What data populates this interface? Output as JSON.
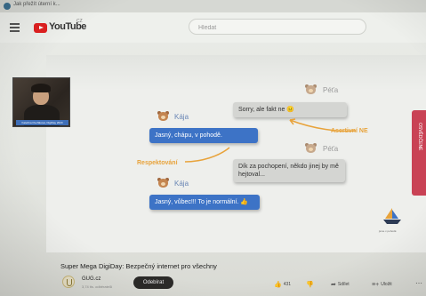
{
  "browser": {
    "tab_title": "Jak přežít úterní k..."
  },
  "header": {
    "logo_text": "YouTube",
    "region": "CZ",
    "search_placeholder": "Hledat"
  },
  "slide": {
    "participants": {
      "kaja_top": "Kája",
      "peta_top": "Péťa",
      "peta_mid": "Péťa",
      "kaja_bottom": "Kája"
    },
    "messages": {
      "peta_sorry": "Sorry, ale fakt ne 😐",
      "kaja_ok": "Jasný, chápu, v pohodě.",
      "peta_thanks": "Dík za pochopení, někdo jinej by mě hejtoval...",
      "kaja_normal": "Jasný, vůbec!!! To je normální. 👍"
    },
    "annotations": {
      "asertivni": "Asertivní NE",
      "respekt": "Respektování"
    },
    "webcam_caption": "Kateřina Dvořáková, DigiDay 2020",
    "side_tab": "OSVĚDČENÉ",
    "boat_caption": "jsme v pohodě"
  },
  "video": {
    "title": "Super Mega DigiDay: Bezpečný internet pro všechny",
    "channel": "GUG.cz",
    "subscribers": "3,74 tis. odběratelů",
    "subscribe_label": "Odebírat"
  },
  "actions": {
    "likes": "431",
    "dislike_icon": "thumb-down-icon",
    "share": "Sdílet",
    "save": "Uložit"
  },
  "colors": {
    "brand_red": "#e02020",
    "bubble_blue": "#3d73c6",
    "accent_orange": "#e8a33b",
    "side_tab": "#c94255"
  }
}
